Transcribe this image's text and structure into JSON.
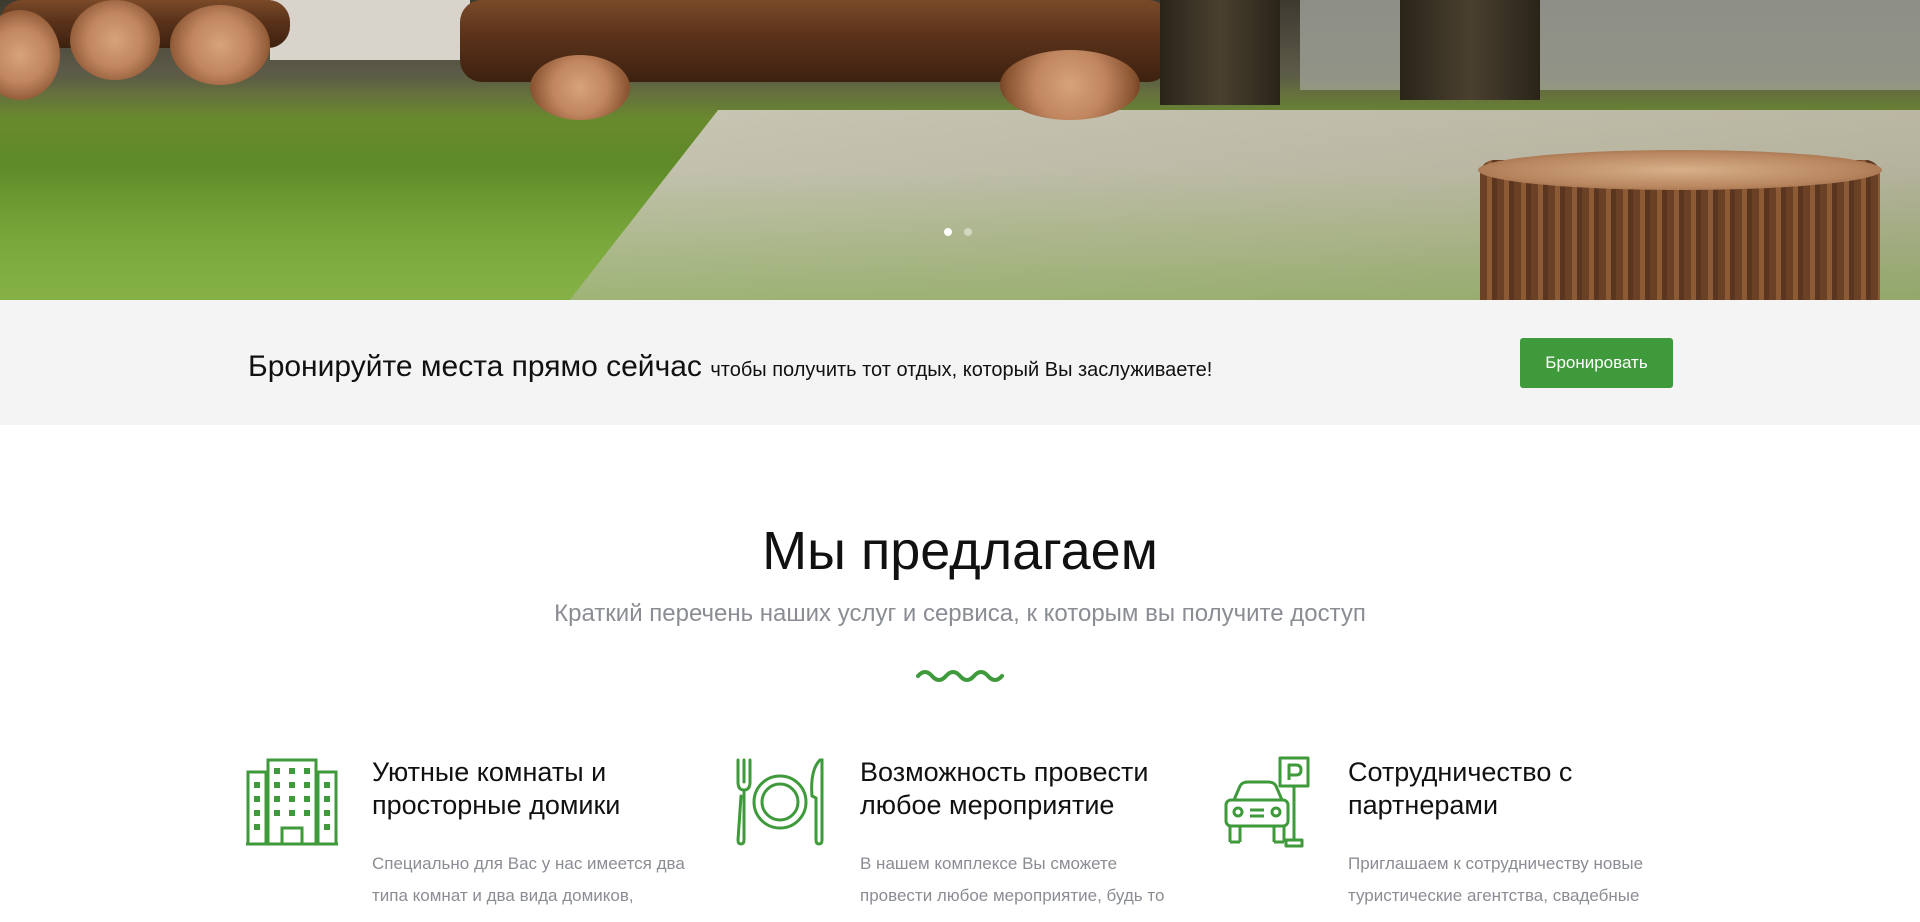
{
  "hero": {
    "carousel_dots": [
      "slide-1",
      "slide-2"
    ],
    "active_slide": 1
  },
  "cta": {
    "title": "Бронируйте места прямо сейчас",
    "subtitle": "чтобы получить тот отдых, который Вы заслуживаете!",
    "button_label": "Бронировать"
  },
  "offer": {
    "title": "Мы предлагаем",
    "subtitle": "Краткий перечень наших услуг и сервиса, к которым вы получите доступ",
    "features": [
      {
        "icon": "building-icon",
        "title": "Уютные комнаты и просторные домики",
        "text": "Специально для Вас у нас имеется два типа комнат и два вида домиков,"
      },
      {
        "icon": "restaurant-icon",
        "title": "Возможность провести любое мероприятие",
        "text": "В нашем комплексе Вы сможете провести любое мероприятие, будь то"
      },
      {
        "icon": "parking-car-icon",
        "title": "Сотрудничество с партнерами",
        "text": "Приглашаем к сотрудничеству новые туристические агентства, свадебные"
      }
    ]
  },
  "colors": {
    "accent": "#3e9a3a",
    "cta_background": "#f4f4f4",
    "muted_text": "#8a8d93"
  }
}
